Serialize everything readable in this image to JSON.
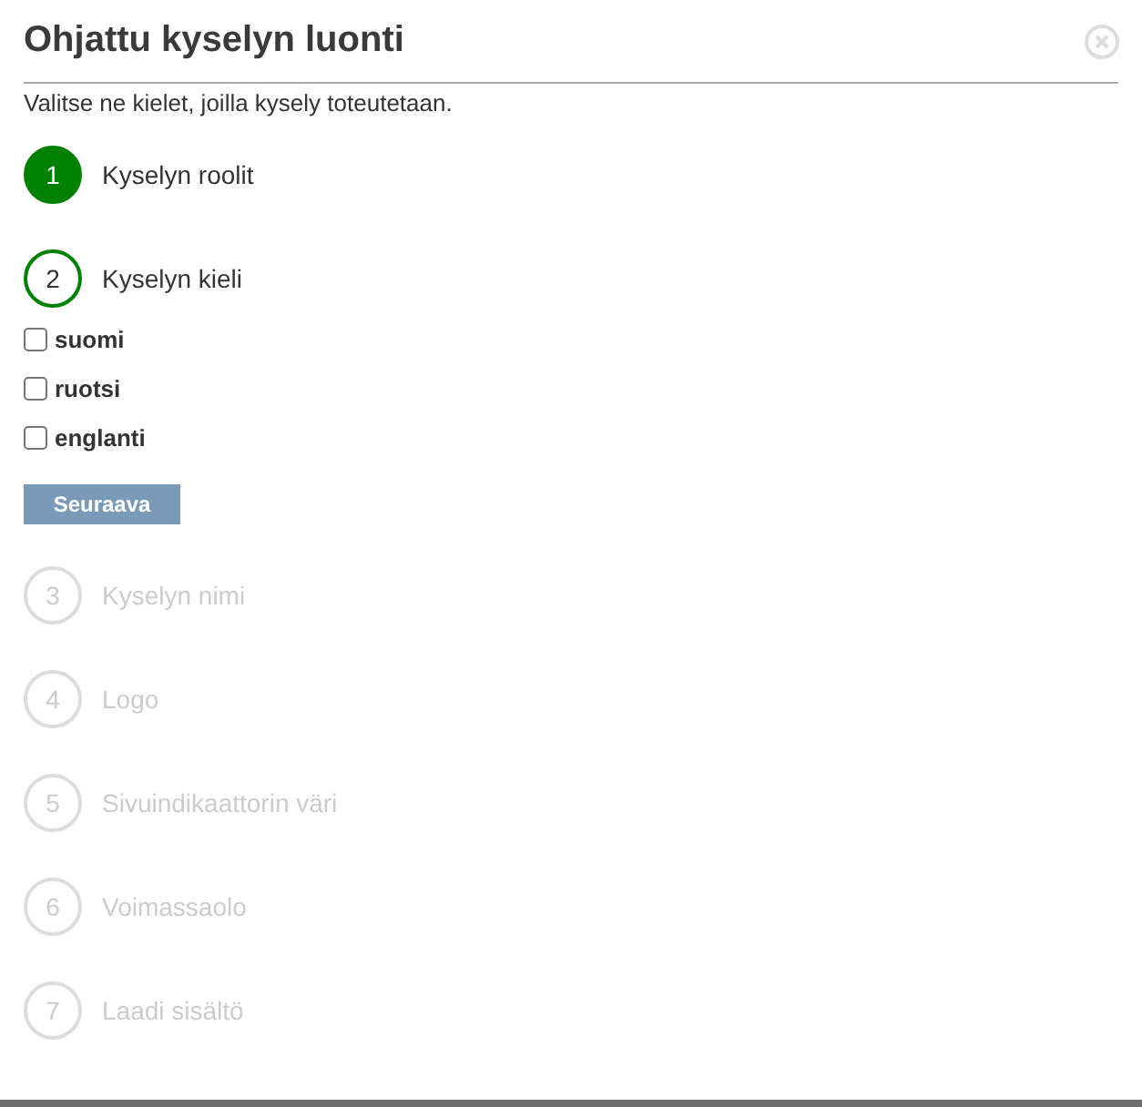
{
  "dialog": {
    "title": "Ohjattu kyselyn luonti",
    "instruction": "Valitse ne kielet, joilla kysely toteutetaan."
  },
  "steps": [
    {
      "number": "1",
      "label": "Kyselyn roolit",
      "done": true,
      "selected": false
    },
    {
      "number": "2",
      "label": "Kyselyn kieli",
      "done": false,
      "selected": true,
      "options": [
        {
          "label": "suomi",
          "checked": false
        },
        {
          "label": "ruotsi",
          "checked": false
        },
        {
          "label": "englanti",
          "checked": false
        }
      ],
      "button": "Seuraava"
    },
    {
      "number": "3",
      "label": "Kyselyn nimi",
      "done": false,
      "selected": false
    },
    {
      "number": "4",
      "label": "Logo",
      "done": false,
      "selected": false
    },
    {
      "number": "5",
      "label": "Sivuindikaattorin väri",
      "done": false,
      "selected": false
    },
    {
      "number": "6",
      "label": "Voimassaolo",
      "done": false,
      "selected": false
    },
    {
      "number": "7",
      "label": "Laadi sisältö",
      "done": false,
      "selected": false
    }
  ]
}
